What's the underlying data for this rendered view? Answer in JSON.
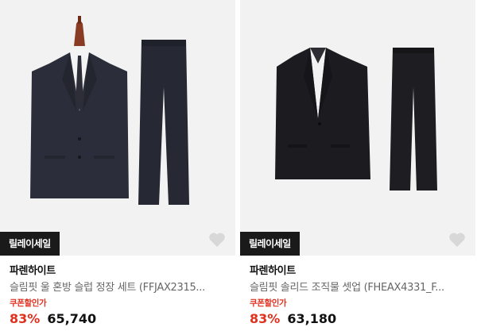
{
  "products": [
    {
      "badge": "릴레이세일",
      "brand": "파렌하이트",
      "title": "슬림핏 울 혼방 슬럽 정장 세트 (FFJAX2315...",
      "coupon_label": "쿠폰할인가",
      "discount": "83%",
      "price": "65,740",
      "wishlist_icon": "heart-icon"
    },
    {
      "badge": "릴레이세일",
      "brand": "파렌하이트",
      "title": "슬림핏 솔리드 조직물 셋업 (FHEAX4331_F...",
      "coupon_label": "쿠폰할인가",
      "discount": "83%",
      "price": "63,180",
      "wishlist_icon": "heart-icon"
    }
  ],
  "colors": {
    "image_bg": "#f2f2f2",
    "badge_bg": "#1a1a1a",
    "accent_red": "#e0301e"
  }
}
